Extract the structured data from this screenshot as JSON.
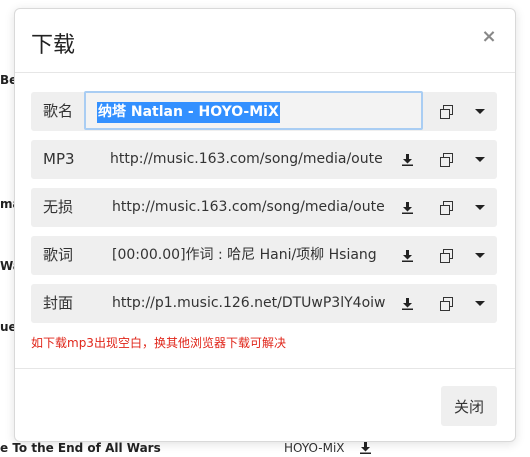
{
  "background": {
    "frag_be": "Be",
    "frag_ma": "ma",
    "frag_wal": "Wal",
    "frag_ue": "ue",
    "bottom_title": "e To the End of All Wars",
    "bottom_artist": "HOYO-MiX"
  },
  "modal": {
    "title": "下载",
    "close_symbol": "×",
    "rows": [
      {
        "label": "歌名",
        "value": "纳塔 Natlan - HOYO-MiX"
      },
      {
        "label": "MP3",
        "value": "http://music.163.com/song/media/oute"
      },
      {
        "label": "无损",
        "value": "http://music.163.com/song/media/oute"
      },
      {
        "label": "歌词",
        "value": "[00:00.00]作词 : 哈尼 Hani/项柳 Hsiang"
      },
      {
        "label": "封面",
        "value": "http://p1.music.126.net/DTUwP3lY4oiw"
      }
    ],
    "warning": "如下载mp3出现空白，换其他浏览器下载可解决",
    "close_button": "关闭"
  },
  "colors": {
    "warning": "#e0261a",
    "selection": "#3390ff",
    "focus_border": "#a9cdf3"
  },
  "icons": [
    "download-icon",
    "copy-icon",
    "caret-down-icon",
    "close-icon"
  ]
}
